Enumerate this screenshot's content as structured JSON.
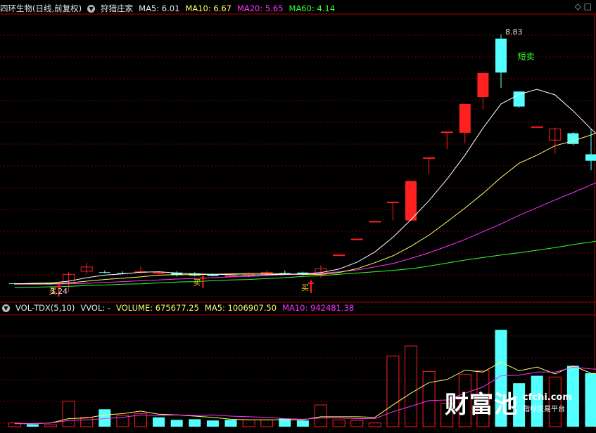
{
  "header": {
    "title": "四环生物(日线,前复权)",
    "indicator": "狩猎庄家",
    "ma5": "MA5: 6.01",
    "ma10": "MA10: 6.67",
    "ma20": "MA20: 5.65",
    "ma60": "MA60: 4.14"
  },
  "vol_header": {
    "name": "VOL-TDX(5,10)",
    "vvol": "VVOL: -",
    "volume": "VOLUME: 675677.25",
    "ma5": "MA5: 1006907.50",
    "ma10": "MA10: 942481.38"
  },
  "colors": {
    "up": "#ff2020",
    "down": "#54ffff",
    "ma5": "#ffffff",
    "ma10": "#ffff66",
    "ma20": "#ff33ff",
    "ma60": "#33ff33",
    "grid": "#7a0000",
    "sell_label": "#33ff33",
    "buy_label": "#ffcc00"
  },
  "chart_data": [
    {
      "type": "candlestick",
      "title": "四环生物(日线,前复权)",
      "ylim": [
        2.6,
        9.3
      ],
      "candles": [
        {
          "o": 3.04,
          "h": 3.05,
          "l": 3.01,
          "c": 3.03
        },
        {
          "o": 3.03,
          "h": 3.05,
          "l": 3.01,
          "c": 3.04
        },
        {
          "o": 3.04,
          "h": 3.05,
          "l": 3.02,
          "c": 3.03
        },
        {
          "o": 3.04,
          "h": 3.3,
          "l": 2.84,
          "c": 3.25
        },
        {
          "o": 3.32,
          "h": 3.52,
          "l": 3.25,
          "c": 3.42
        },
        {
          "o": 3.3,
          "h": 3.34,
          "l": 3.27,
          "c": 3.29
        },
        {
          "o": 3.28,
          "h": 3.32,
          "l": 3.25,
          "c": 3.27
        },
        {
          "o": 3.3,
          "h": 3.43,
          "l": 3.26,
          "c": 3.31
        },
        {
          "o": 3.28,
          "h": 3.32,
          "l": 3.25,
          "c": 3.29
        },
        {
          "o": 3.29,
          "h": 3.32,
          "l": 3.2,
          "c": 3.23
        },
        {
          "o": 3.27,
          "h": 3.3,
          "l": 3.2,
          "c": 3.22
        },
        {
          "o": 3.24,
          "h": 3.27,
          "l": 3.2,
          "c": 3.21
        },
        {
          "o": 3.2,
          "h": 3.24,
          "l": 3.18,
          "c": 3.22
        },
        {
          "o": 3.23,
          "h": 3.29,
          "l": 3.18,
          "c": 3.25
        },
        {
          "o": 3.26,
          "h": 3.35,
          "l": 3.21,
          "c": 3.29
        },
        {
          "o": 3.28,
          "h": 3.34,
          "l": 3.24,
          "c": 3.27
        },
        {
          "o": 3.29,
          "h": 3.31,
          "l": 3.22,
          "c": 3.24
        },
        {
          "o": 3.24,
          "h": 3.46,
          "l": 3.17,
          "c": 3.38
        },
        {
          "o": 3.7,
          "h": 3.7,
          "l": 3.7,
          "c": 3.7
        },
        {
          "o": 4.07,
          "h": 4.07,
          "l": 4.07,
          "c": 4.07
        },
        {
          "o": 4.48,
          "h": 4.48,
          "l": 4.48,
          "c": 4.48
        },
        {
          "o": 4.93,
          "h": 4.93,
          "l": 4.5,
          "c": 4.93
        },
        {
          "o": 4.5,
          "h": 5.42,
          "l": 4.5,
          "c": 5.42
        },
        {
          "o": 5.96,
          "h": 5.96,
          "l": 5.58,
          "c": 5.96
        },
        {
          "o": 6.56,
          "h": 6.56,
          "l": 6.16,
          "c": 6.56
        },
        {
          "o": 6.54,
          "h": 7.21,
          "l": 6.3,
          "c": 7.21
        },
        {
          "o": 7.37,
          "h": 7.93,
          "l": 7.08,
          "c": 7.93
        },
        {
          "o": 8.73,
          "h": 8.83,
          "l": 7.58,
          "c": 7.94
        },
        {
          "o": 7.5,
          "h": 7.5,
          "l": 7.12,
          "c": 7.15
        },
        {
          "o": 6.68,
          "h": 6.68,
          "l": 6.68,
          "c": 6.68
        },
        {
          "o": 6.37,
          "h": 6.66,
          "l": 6.05,
          "c": 6.63
        },
        {
          "o": 6.53,
          "h": 6.56,
          "l": 6.25,
          "c": 6.28
        },
        {
          "o": 6.04,
          "h": 6.62,
          "l": 5.67,
          "c": 5.89
        },
        {
          "o": 5.85,
          "h": 5.86,
          "l": 5.67,
          "c": 5.73
        },
        {
          "o": 5.7,
          "h": 5.78,
          "l": 5.62,
          "c": 5.74
        }
      ],
      "ma5": [
        3.03,
        3.04,
        3.05,
        3.09,
        3.17,
        3.23,
        3.26,
        3.3,
        3.31,
        3.28,
        3.26,
        3.25,
        3.24,
        3.23,
        3.24,
        3.25,
        3.26,
        3.29,
        3.37,
        3.53,
        3.77,
        4.11,
        4.52,
        4.96,
        5.46,
        6.02,
        6.65,
        7.21,
        7.43,
        7.55,
        7.42,
        7.05,
        6.63,
        6.24,
        6.05
      ],
      "ma10": [
        3.03,
        3.03,
        3.03,
        3.05,
        3.09,
        3.13,
        3.16,
        3.19,
        3.23,
        3.24,
        3.24,
        3.25,
        3.26,
        3.27,
        3.27,
        3.26,
        3.25,
        3.25,
        3.29,
        3.38,
        3.52,
        3.68,
        3.9,
        4.16,
        4.47,
        4.79,
        5.13,
        5.5,
        5.83,
        6.02,
        6.24,
        6.35,
        6.49,
        6.65,
        6.67
      ],
      "ma20": [
        3.02,
        3.02,
        3.02,
        3.03,
        3.04,
        3.06,
        3.08,
        3.1,
        3.12,
        3.14,
        3.15,
        3.17,
        3.19,
        3.2,
        3.22,
        3.24,
        3.25,
        3.27,
        3.31,
        3.35,
        3.42,
        3.5,
        3.62,
        3.75,
        3.9,
        4.06,
        4.24,
        4.42,
        4.62,
        4.8,
        4.98,
        5.15,
        5.33,
        5.5,
        5.65
      ],
      "ma60": [
        2.94,
        2.95,
        2.96,
        2.97,
        2.99,
        3.0,
        3.02,
        3.03,
        3.05,
        3.07,
        3.08,
        3.1,
        3.12,
        3.13,
        3.15,
        3.17,
        3.2,
        3.22,
        3.25,
        3.28,
        3.31,
        3.34,
        3.38,
        3.44,
        3.51,
        3.58,
        3.64,
        3.7,
        3.75,
        3.81,
        3.87,
        3.94,
        4.0,
        4.07,
        4.14
      ],
      "annotations": [
        {
          "text": "8.83",
          "index": 27,
          "value": 8.83
        },
        {
          "text": "短卖",
          "index": 28,
          "value": 8.25
        },
        {
          "text": "买",
          "index": 3,
          "value": 2.8
        },
        {
          "text": "3.24",
          "index": 3,
          "value": 2.8
        },
        {
          "text": "买",
          "index": 11,
          "value": 3.0
        },
        {
          "text": "买",
          "index": 17,
          "value": 2.88
        }
      ]
    },
    {
      "type": "bar",
      "title": "VOL-TDX(5,10)",
      "ylim": [
        0,
        1800000
      ],
      "volume": [
        60000,
        40000,
        30000,
        410000,
        150000,
        280000,
        180000,
        210000,
        150000,
        110000,
        120000,
        100000,
        110000,
        110000,
        110000,
        130000,
        100000,
        350000,
        110000,
        100000,
        60000,
        1140000,
        1300000,
        890000,
        370000,
        840000,
        900000,
        1560000,
        700000,
        820000,
        800000,
        980000,
        860000,
        820000,
        630000
      ],
      "up": [
        true,
        false,
        true,
        true,
        true,
        false,
        true,
        true,
        false,
        false,
        false,
        false,
        false,
        true,
        true,
        false,
        false,
        true,
        true,
        true,
        true,
        true,
        true,
        true,
        true,
        true,
        true,
        false,
        false,
        false,
        true,
        false,
        false,
        true,
        true
      ],
      "ma5": [
        50000,
        50000,
        60000,
        130000,
        140000,
        190000,
        210000,
        250000,
        200000,
        190000,
        170000,
        150000,
        120000,
        110000,
        110000,
        110000,
        110000,
        160000,
        160000,
        160000,
        150000,
        350000,
        540000,
        710000,
        760000,
        910000,
        880000,
        1040000,
        900000,
        960000,
        850000,
        980000,
        860000,
        840000,
        1006907
      ],
      "ma10": [
        50000,
        50000,
        60000,
        100000,
        110000,
        130000,
        150000,
        190000,
        180000,
        190000,
        180000,
        190000,
        170000,
        160000,
        150000,
        130000,
        120000,
        140000,
        140000,
        130000,
        130000,
        240000,
        330000,
        420000,
        430000,
        540000,
        640000,
        820000,
        830000,
        880000,
        880000,
        960000,
        930000,
        920000,
        942481
      ]
    }
  ],
  "watermark": {
    "big": "财富池",
    "url": "cfchi.com",
    "sub": "指标交易平台"
  }
}
